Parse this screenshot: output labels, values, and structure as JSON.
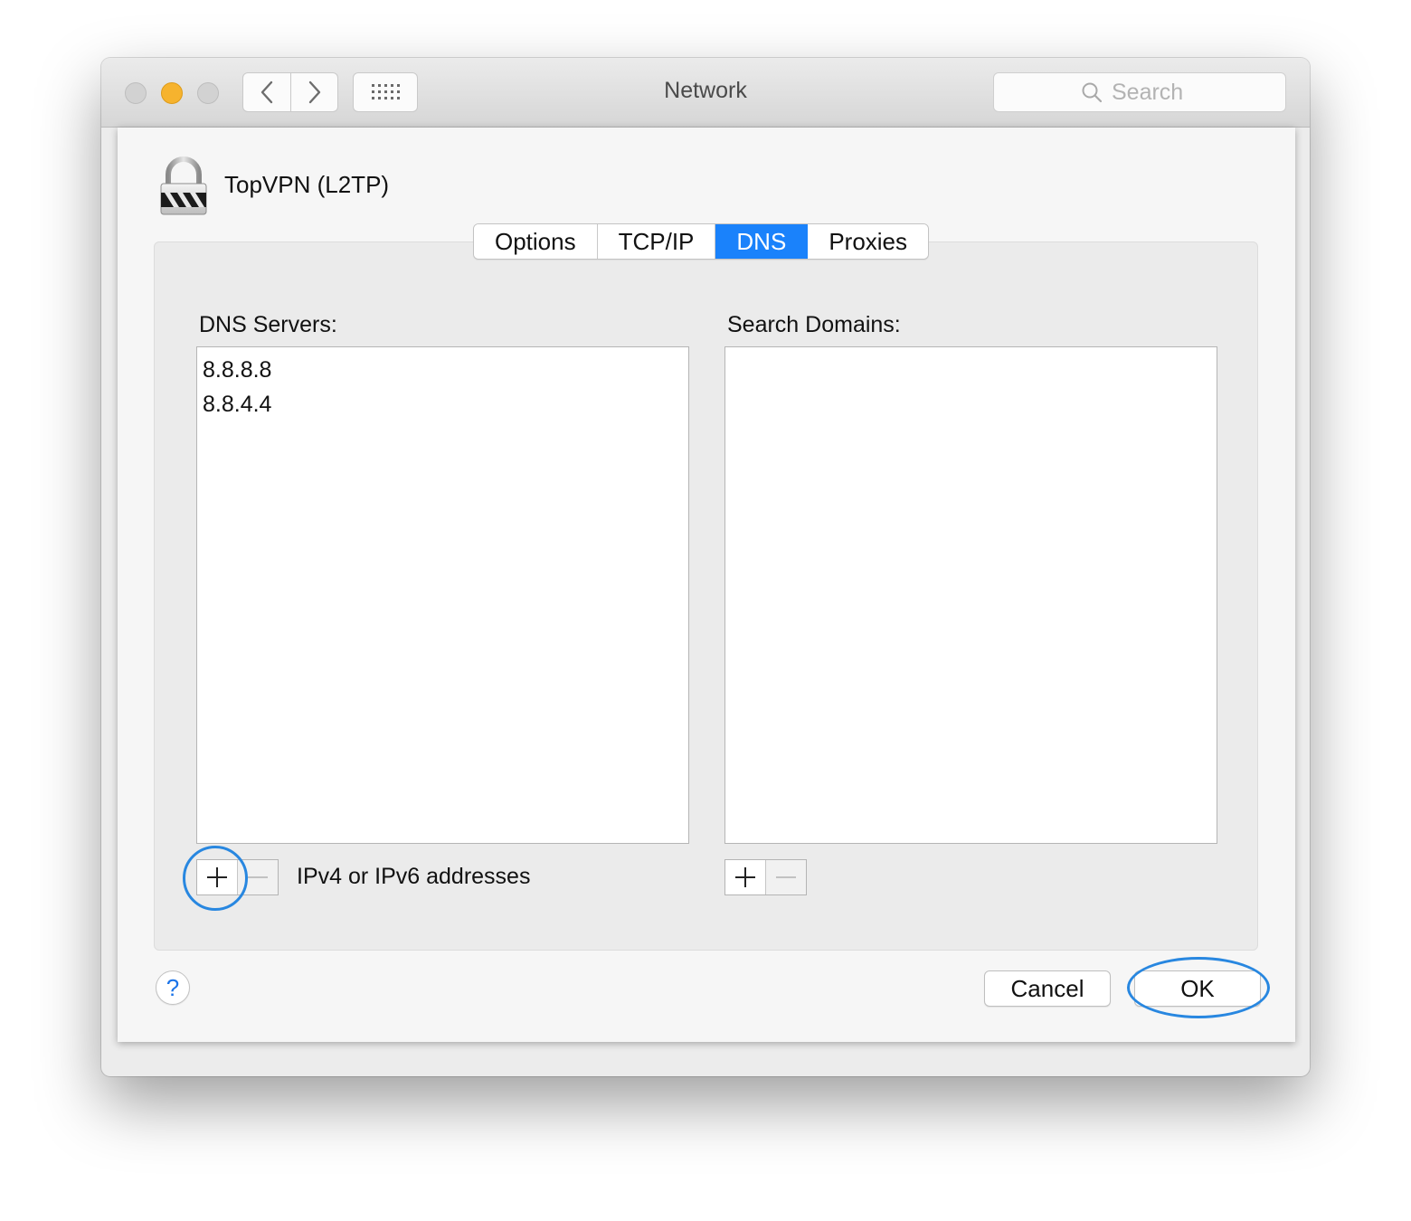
{
  "window": {
    "title": "Network"
  },
  "toolbar": {
    "back_icon": "chevron-left-icon",
    "forward_icon": "chevron-right-icon",
    "grid_icon": "show-all-grid-icon",
    "search": {
      "placeholder": "Search",
      "icon": "search-icon"
    }
  },
  "connection": {
    "name": "TopVPN (L2TP)",
    "icon": "vpn-lock-icon"
  },
  "tabs": [
    {
      "label": "Options",
      "active": false
    },
    {
      "label": "TCP/IP",
      "active": false
    },
    {
      "label": "DNS",
      "active": true
    },
    {
      "label": "Proxies",
      "active": false
    }
  ],
  "dns_servers": {
    "label": "DNS Servers:",
    "items": [
      "8.8.8.8",
      "8.8.4.4"
    ],
    "hint": "IPv4 or IPv6 addresses"
  },
  "search_domains": {
    "label": "Search Domains:",
    "items": []
  },
  "buttons": {
    "cancel": "Cancel",
    "ok": "OK",
    "help": "?"
  },
  "colors": {
    "accent": "#1a82fb",
    "highlight_ring": "#2887e0",
    "minimize_light": "#f6b32e"
  }
}
